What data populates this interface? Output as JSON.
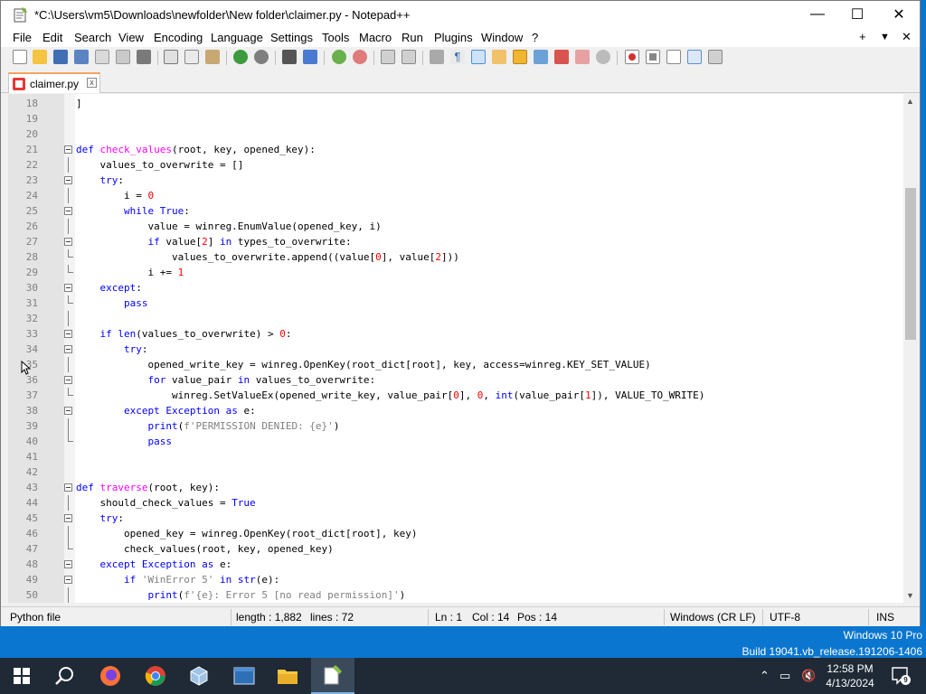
{
  "window": {
    "title": "*C:\\Users\\vm5\\Downloads\\newfolder\\New folder\\claimer.py - Notepad++",
    "minimize": "—",
    "maximize": "☐",
    "close": "✕"
  },
  "menu": {
    "items": [
      "File",
      "Edit",
      "Search",
      "View",
      "Encoding",
      "Language",
      "Settings",
      "Tools",
      "Macro",
      "Run",
      "Plugins",
      "Window",
      "?"
    ],
    "right_plus": "+",
    "right_down": "▼",
    "right_close": "✕"
  },
  "tab": {
    "label": "claimer.py",
    "close": "x"
  },
  "code_lines": [
    {
      "n": "18",
      "h": "]"
    },
    {
      "n": "19",
      "h": ""
    },
    {
      "n": "20",
      "h": ""
    },
    {
      "n": "21",
      "h": "<span class=\"kw\">def</span> <span class=\"fn\">check_values</span>(root, key, opened_key):"
    },
    {
      "n": "22",
      "h": "    values_to_overwrite = []"
    },
    {
      "n": "23",
      "h": "    <span class=\"kw\">try</span>:"
    },
    {
      "n": "24",
      "h": "        i = <span class=\"num\">0</span>"
    },
    {
      "n": "25",
      "h": "        <span class=\"kw\">while</span> <span class=\"kw\">True</span>:"
    },
    {
      "n": "26",
      "h": "            value = winreg.EnumValue(opened_key, i)"
    },
    {
      "n": "27",
      "h": "            <span class=\"kw\">if</span> value[<span class=\"num\">2</span>] <span class=\"kw\">in</span> types_to_overwrite:"
    },
    {
      "n": "28",
      "h": "                values_to_overwrite.append((value[<span class=\"num\">0</span>], value[<span class=\"num\">2</span>]))"
    },
    {
      "n": "29",
      "h": "            i += <span class=\"num\">1</span>"
    },
    {
      "n": "30",
      "h": "    <span class=\"kw\">except</span>:"
    },
    {
      "n": "31",
      "h": "        <span class=\"kw\">pass</span>"
    },
    {
      "n": "32",
      "h": ""
    },
    {
      "n": "33",
      "h": "    <span class=\"kw\">if</span> <span class=\"kw\">len</span>(values_to_overwrite) &gt; <span class=\"num\">0</span>:"
    },
    {
      "n": "34",
      "h": "        <span class=\"kw\">try</span>:"
    },
    {
      "n": "35",
      "h": "            opened_write_key = winreg.OpenKey(root_dict[root], key, access=winreg.KEY_SET_VALUE)"
    },
    {
      "n": "36",
      "h": "            <span class=\"kw\">for</span> value_pair <span class=\"kw\">in</span> values_to_overwrite:"
    },
    {
      "n": "37",
      "h": "                winreg.SetValueEx(opened_write_key, value_pair[<span class=\"num\">0</span>], <span class=\"num\">0</span>, <span class=\"kw\">int</span>(value_pair[<span class=\"num\">1</span>]), VALUE_TO_WRITE)"
    },
    {
      "n": "38",
      "h": "        <span class=\"kw\">except</span> <span class=\"kw\">Exception</span> <span class=\"kw\">as</span> e:"
    },
    {
      "n": "39",
      "h": "            <span class=\"kw\">print</span>(<span class=\"str\">f'PERMISSION DENIED: {e}'</span>)"
    },
    {
      "n": "40",
      "h": "            <span class=\"kw\">pass</span>"
    },
    {
      "n": "41",
      "h": ""
    },
    {
      "n": "42",
      "h": ""
    },
    {
      "n": "43",
      "h": "<span class=\"kw\">def</span> <span class=\"fn\">traverse</span>(root, key):"
    },
    {
      "n": "44",
      "h": "    should_check_values = <span class=\"kw\">True</span>"
    },
    {
      "n": "45",
      "h": "    <span class=\"kw\">try</span>:"
    },
    {
      "n": "46",
      "h": "        opened_key = winreg.OpenKey(root_dict[root], key)"
    },
    {
      "n": "47",
      "h": "        check_values(root, key, opened_key)"
    },
    {
      "n": "48",
      "h": "    <span class=\"kw\">except</span> <span class=\"kw\">Exception</span> <span class=\"kw\">as</span> e:"
    },
    {
      "n": "49",
      "h": "        <span class=\"kw\">if</span> <span class=\"str\">'WinError 5'</span> <span class=\"kw\">in</span> <span class=\"kw\">str</span>(e):"
    },
    {
      "n": "50",
      "h": "            <span class=\"kw\">print</span>(<span class=\"str\">f'{e}: Error 5 [no read permission]'</span>)"
    }
  ],
  "status": {
    "file_type": "Python file",
    "length": "length : 1,882",
    "lines": "lines : 72",
    "ln": "Ln : 1",
    "col": "Col : 14",
    "pos": "Pos : 14",
    "eol": "Windows (CR LF)",
    "encoding": "UTF-8",
    "mode": "INS"
  },
  "watermark": {
    "line1": "Windows 10 Pro",
    "line2": "Build 19041.vb_release.191206-1406"
  },
  "tray": {
    "time": "12:58 PM",
    "date": "4/13/2024",
    "notifications": "9"
  },
  "colors": {
    "keyword": "#0000ff",
    "function": "#ff00ff",
    "number": "#ff0000",
    "string": "#808080",
    "desktop": "#0a76cf",
    "taskbar": "#1f2a36"
  }
}
